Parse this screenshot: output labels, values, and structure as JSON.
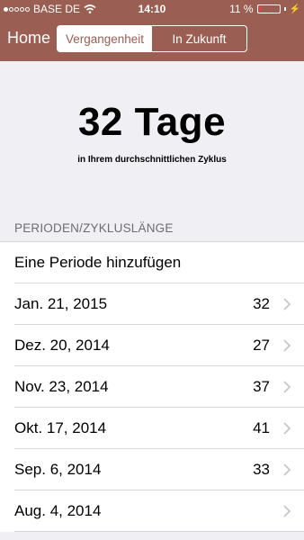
{
  "status": {
    "carrier": "BASE DE",
    "time": "14:10",
    "battery": "11 %",
    "battery_level": 0.11,
    "battery_color": "#e04343"
  },
  "nav": {
    "home": "Home",
    "segments": [
      "Vergangenheit",
      "In Zukunft"
    ],
    "selected": "Vergangenheit",
    "bar_color": "#9a5e52"
  },
  "hero": {
    "title": "32 Tage",
    "subtitle": "in Ihrem durchschnittlichen Zyklus"
  },
  "section": {
    "header": "PERIODEN/ZYKLUSLÄNGE"
  },
  "list": {
    "add_label": "Eine Periode hinzufügen",
    "periods": [
      {
        "date": "Jan. 21, 2015",
        "length": "32"
      },
      {
        "date": "Dez. 20, 2014",
        "length": "27"
      },
      {
        "date": "Nov. 23, 2014",
        "length": "37"
      },
      {
        "date": "Okt. 17, 2014",
        "length": "41"
      },
      {
        "date": "Sep. 6, 2014",
        "length": "33"
      },
      {
        "date": "Aug. 4, 2014",
        "length": ""
      }
    ]
  }
}
